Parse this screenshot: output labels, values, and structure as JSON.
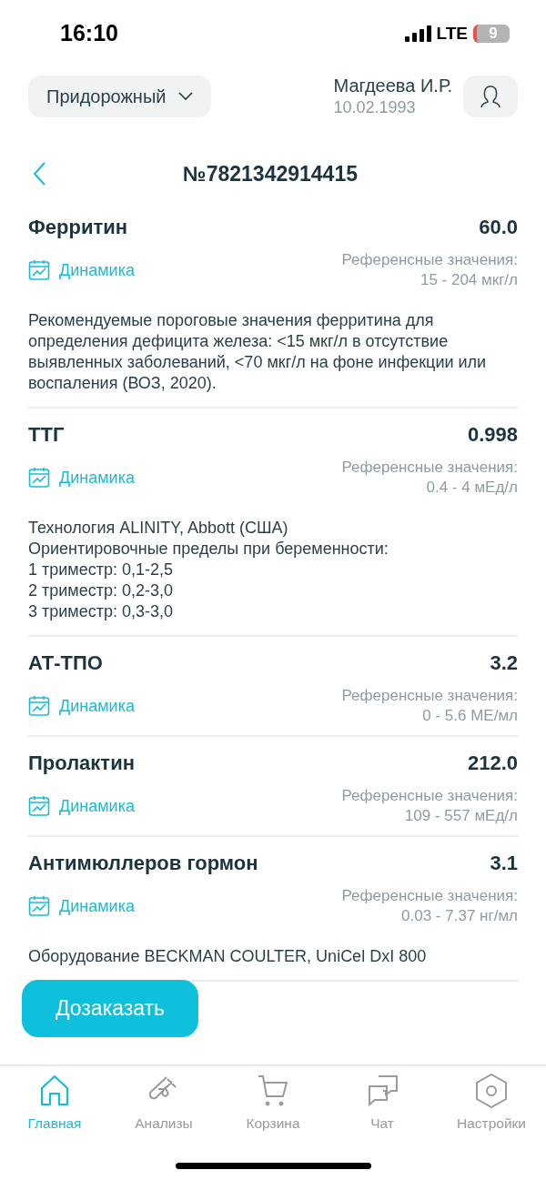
{
  "status_bar": {
    "time": "16:10",
    "network": "LTE",
    "battery_text": "9"
  },
  "header": {
    "branch": "Придорожный",
    "patient_name": "Магдеева И.Р.",
    "birth_date": "10.02.1993"
  },
  "order": {
    "title": "№7821342914415"
  },
  "results": [
    {
      "name": "Ферритин",
      "value": "60.0",
      "dynamics": "Динамика",
      "reference_label": "Референсные значения:",
      "reference_range": "15 - 204 мкг/л",
      "note": "Рекомендуемые пороговые значения ферритина для определения дефицита железа: <15 мкг/л в отсутствие выявленных заболеваний, <70 мкг/л на фоне инфекции или воспаления (ВОЗ, 2020)."
    },
    {
      "name": "ТТГ",
      "value": "0.998",
      "dynamics": "Динамика",
      "reference_label": "Референсные значения:",
      "reference_range": "0.4 - 4 мЕд/л",
      "note": "Технология ALINITY, Abbott (США)\nОриентировочные пределы при беременности:\n1 триместр: 0,1-2,5\n2 триместр: 0,2-3,0\n3 триместр: 0,3-3,0"
    },
    {
      "name": "АТ-ТПО",
      "value": "3.2",
      "dynamics": "Динамика",
      "reference_label": "Референсные значения:",
      "reference_range": "0 - 5.6 МЕ/мл"
    },
    {
      "name": "Пролактин",
      "value": "212.0",
      "dynamics": "Динамика",
      "reference_label": "Референсные значения:",
      "reference_range": "109 - 557 мЕд/л"
    },
    {
      "name": "Антимюллеров гормон",
      "value": "3.1",
      "dynamics": "Динамика",
      "reference_label": "Референсные значения:",
      "reference_range": "0.03 - 7.37 нг/мл",
      "note": "Оборудование BECKMAN COULTER, UniCel DxI 800"
    }
  ],
  "reorder_button": "Дозаказать",
  "tabs": [
    {
      "kind": "home",
      "label": "Главная",
      "selected": true
    },
    {
      "kind": "tests",
      "label": "Анализы",
      "selected": false
    },
    {
      "kind": "cart",
      "label": "Корзина",
      "selected": false
    },
    {
      "kind": "chat",
      "label": "Чат",
      "selected": false
    },
    {
      "kind": "settings",
      "label": "Настройки",
      "selected": false
    }
  ]
}
